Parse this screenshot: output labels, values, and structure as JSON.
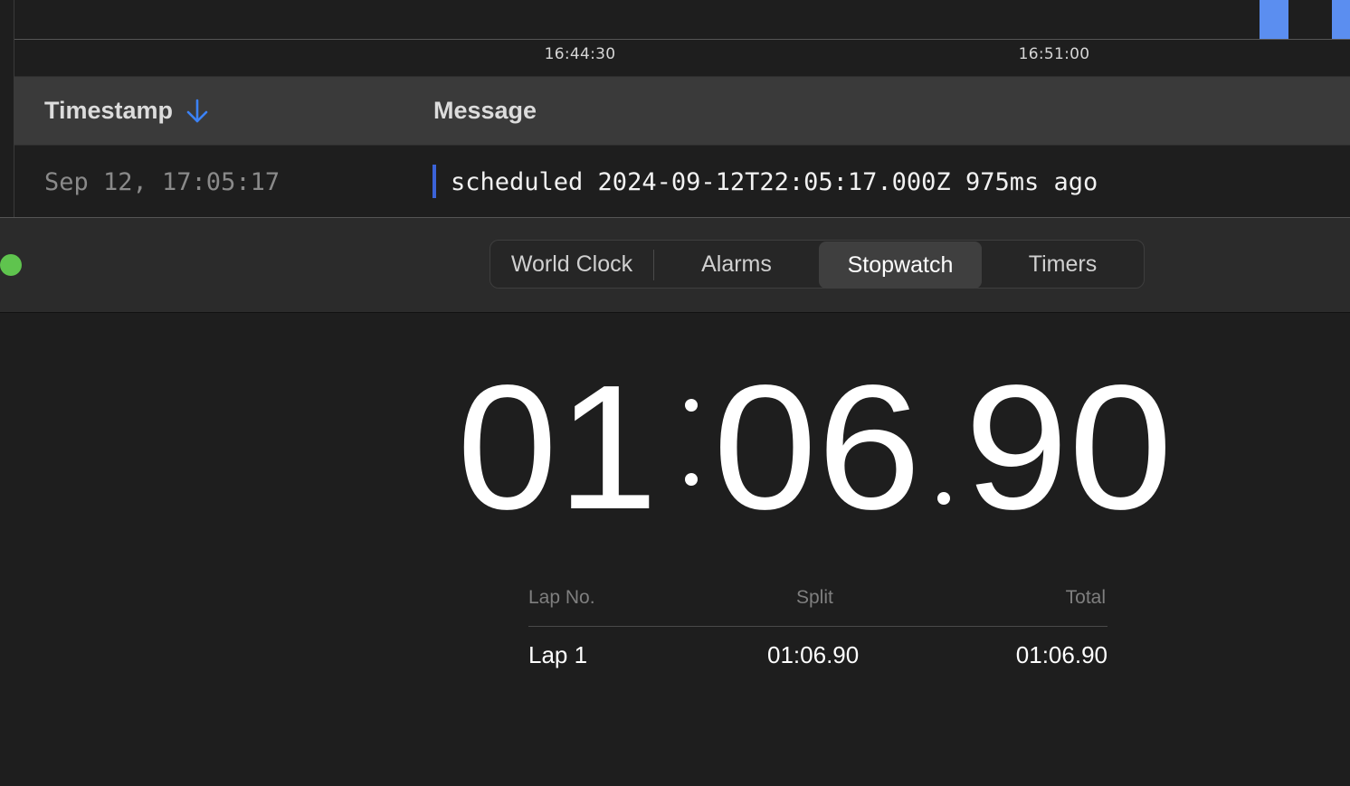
{
  "log": {
    "axis_ticks": [
      "16:44:30",
      "16:51:00"
    ],
    "columns": {
      "timestamp": "Timestamp",
      "message": "Message"
    },
    "sort_icon": "arrow-down-icon",
    "rows": [
      {
        "timestamp": "Sep 12, 17:05:17",
        "message": "scheduled 2024-09-12T22:05:17.000Z 975ms ago"
      }
    ],
    "accent": "#5b8ef0"
  },
  "clock": {
    "tabs": [
      "World Clock",
      "Alarms",
      "Stopwatch",
      "Timers"
    ],
    "active_tab": "Stopwatch",
    "stopwatch": {
      "minutes": "01",
      "seconds": "06",
      "hundredths": "90"
    },
    "laps": {
      "headers": {
        "lap": "Lap No.",
        "split": "Split",
        "total": "Total"
      },
      "rows": [
        {
          "lap": "Lap 1",
          "split": "01:06.90",
          "total": "01:06.90"
        }
      ]
    },
    "traffic_light_color": "#5fc44e"
  }
}
